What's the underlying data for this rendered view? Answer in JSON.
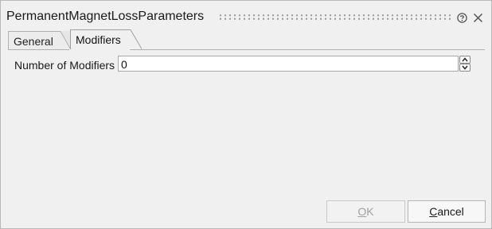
{
  "dialog": {
    "title": "PermanentMagnetLossParameters"
  },
  "tabs": [
    {
      "label": "General",
      "active": false
    },
    {
      "label": "Modifiers",
      "active": true
    }
  ],
  "fields": {
    "number_of_modifiers": {
      "label": "Number of Modifiers",
      "value": "0"
    }
  },
  "buttons": {
    "ok": {
      "mnemonic": "O",
      "rest": "K",
      "enabled": false
    },
    "cancel": {
      "mnemonic": "C",
      "rest": "ancel",
      "enabled": true
    }
  },
  "icons": {
    "help": "help-circle-icon",
    "close": "close-icon"
  }
}
